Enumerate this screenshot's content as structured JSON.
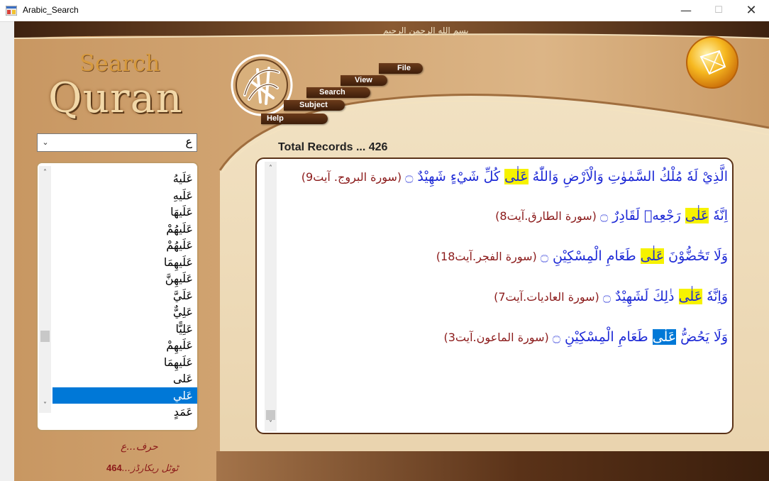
{
  "window": {
    "title": "Arabic_Search",
    "minimize_glyph": "—",
    "maximize_glyph": "☐",
    "close_glyph": "✕"
  },
  "header": {
    "logo_line1": "Search",
    "logo_line2": "Quran",
    "basmala": "بسم الله الرحمن الرحيم"
  },
  "menu": {
    "file": "File",
    "view": "View",
    "search": "Search",
    "subject": "Subject",
    "help": "Help"
  },
  "combo": {
    "value": "ع",
    "arrow": "⌄"
  },
  "word_list": {
    "items": [
      "عَلَيهُ",
      "عَلَيهِ",
      "عَلَيهَا",
      "عَلَيهُمْ",
      "عَلَيهُمْ",
      "عَلَيهِمَا",
      "عَلَيهِنَّ",
      "عَلَيَّ",
      "عَلِيٌّ",
      "عَلِيًّا",
      "عَلَيهِمْ",
      "عَلَيهِمَا",
      "عَلى",
      "عَلي",
      "عَمَدٍ"
    ],
    "selected_index": 13,
    "scroll_up": "˄",
    "scroll_down": "˅"
  },
  "left_labels": {
    "harf": "حرف...ع",
    "total_prefix": "ٹوٹل ریکارڈز...",
    "total_count": "464"
  },
  "results": {
    "total_records_label": "Total Records ... 426",
    "scroll_up": "˄",
    "scroll_down": "˅",
    "verses": [
      {
        "before": "الَّذِيْ لَهٗ مُلْكُ السَّمٰوٰتِ وَالْاَرْضِ وَاللّٰهُ ",
        "word": "عَلٰى",
        "after": " كُلِّ شَيْءٍ شَهِيْدٌ ۝",
        "ref": " (سورة البروج. آيت9)",
        "word_style": "yellow"
      },
      {
        "before": "اِنَّهٗ ",
        "word": "عَلٰى",
        "after": " رَجْعِهٖ لَقَادِرٌ ۝",
        "ref": " (سورة الطارق.آيت8)",
        "word_style": "yellow"
      },
      {
        "before": "وَلَا تَحٰٓضُّوْنَ ",
        "word": "عَلٰى",
        "after": " طَعَامِ الْمِسْكِيْنِ ۝",
        "ref": " (سورة الفجر.آيت18)",
        "word_style": "yellow"
      },
      {
        "before": "وَاِنَّهٗ ",
        "word": "عَلٰى",
        "after": " ذٰلِكَ لَشَهِيْدٌ ۝",
        "ref": " (سورة العاديات.آيت7)",
        "word_style": "yellow"
      },
      {
        "before": "وَلَا يَحُضُّ ",
        "word": "عَلٰى",
        "after": " طَعَامِ الْمِسْكِيْنِ ۝",
        "ref": " (سورة الماعون.آيت3)",
        "word_style": "selected"
      }
    ]
  }
}
